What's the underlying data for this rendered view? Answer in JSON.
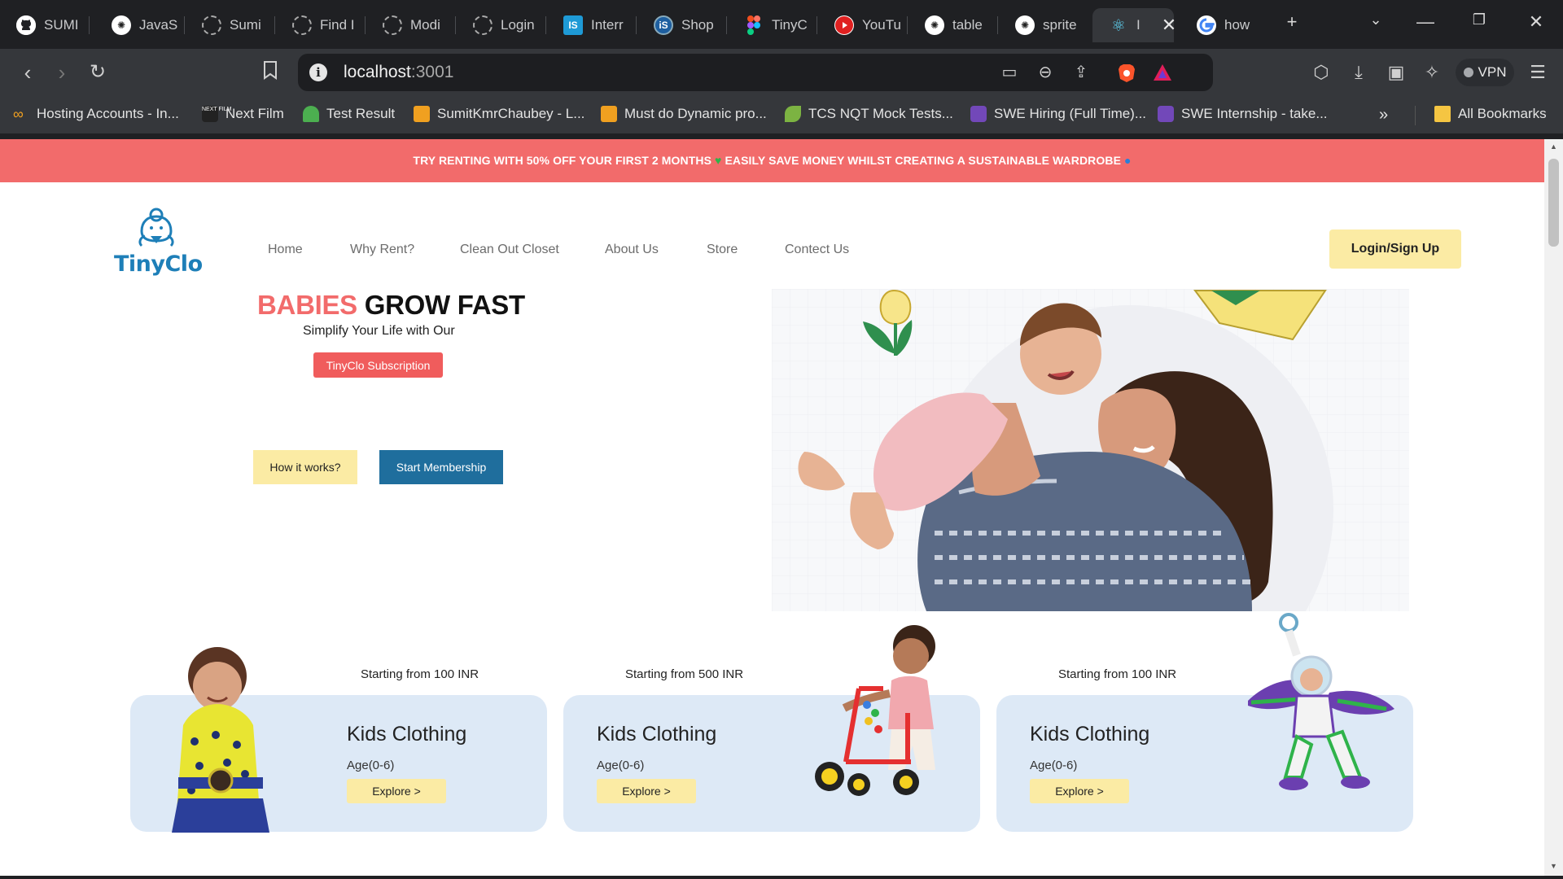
{
  "browser": {
    "tabs": [
      {
        "label": "SUMI",
        "icon": "github-icon"
      },
      {
        "label": "JavaS",
        "icon": "chatgpt-icon"
      },
      {
        "label": "Sumi",
        "icon": "loading-spinner-icon"
      },
      {
        "label": "Find I",
        "icon": "loading-spinner-icon"
      },
      {
        "label": "Modi",
        "icon": "loading-spinner-icon"
      },
      {
        "label": "Login",
        "icon": "loading-spinner-icon"
      },
      {
        "label": "Interr",
        "icon": "is-logo-icon"
      },
      {
        "label": "Shop",
        "icon": "is-logo-icon"
      },
      {
        "label": "TinyC",
        "icon": "figma-icon"
      },
      {
        "label": "YouTu",
        "icon": "youtube-icon"
      },
      {
        "label": "table",
        "icon": "chatgpt-icon"
      },
      {
        "label": "sprite",
        "icon": "chatgpt-icon"
      },
      {
        "label": "I",
        "icon": "react-icon",
        "active": true
      },
      {
        "label": "how",
        "icon": "google-icon"
      }
    ],
    "url": {
      "host": "localhost",
      "port": ":3001"
    },
    "vpn_label": "VPN",
    "bookmarks": [
      {
        "label": "Hosting Accounts - In...",
        "icon": "infinity-icon"
      },
      {
        "label": "Next Film",
        "icon": "nextfilm-icon"
      },
      {
        "label": "Test Result",
        "icon": "umbrella-icon"
      },
      {
        "label": "SumitKmrChaubey - L...",
        "icon": "leetcode-icon"
      },
      {
        "label": "Must do Dynamic pro...",
        "icon": "leetcode-icon"
      },
      {
        "label": "TCS NQT Mock Tests...",
        "icon": "bird-icon"
      },
      {
        "label": "SWE Hiring (Full Time)...",
        "icon": "form-icon"
      },
      {
        "label": "SWE Internship - take...",
        "icon": "form-icon"
      }
    ],
    "all_bookmarks_label": "All Bookmarks"
  },
  "promo": {
    "text_1": "TRY RENTING WITH 50% OFF YOUR FIRST 2 MONTHS",
    "text_2": "EASILY SAVE MONEY WHILST CREATING A SUSTAINABLE WARDROBE"
  },
  "header": {
    "logo_text": "TinyClo",
    "nav": [
      "Home",
      "Why Rent?",
      "Clean Out Closet",
      "About Us",
      "Store",
      "Contect Us"
    ],
    "login_label": "Login/Sign Up"
  },
  "hero": {
    "headline_highlight": "BABIES",
    "headline_rest": " GROW FAST",
    "subline": "Simplify Your Life with Our",
    "subscription_label": "TinyClo Subscription",
    "how_label": "How it works?",
    "start_label": "Start Membership"
  },
  "cards": [
    {
      "price": "Starting from 100 INR",
      "title": "Kids Clothing",
      "age": "Age(0-6)",
      "button": "Explore >"
    },
    {
      "price": "Starting from 500 INR",
      "title": "Kids Clothing",
      "age": "Age(0-6)",
      "button": "Explore >"
    },
    {
      "price": "Starting from 100 INR",
      "title": "Kids Clothing",
      "age": "Age(0-6)",
      "button": "Explore >"
    }
  ],
  "colors": {
    "promo_bg": "#f26b6b",
    "accent_red": "#f26b6b",
    "brand_blue": "#1e7fb8",
    "button_yellow": "#fbeba4",
    "button_blue": "#1f6e9d",
    "card_bg": "#dde9f6"
  }
}
